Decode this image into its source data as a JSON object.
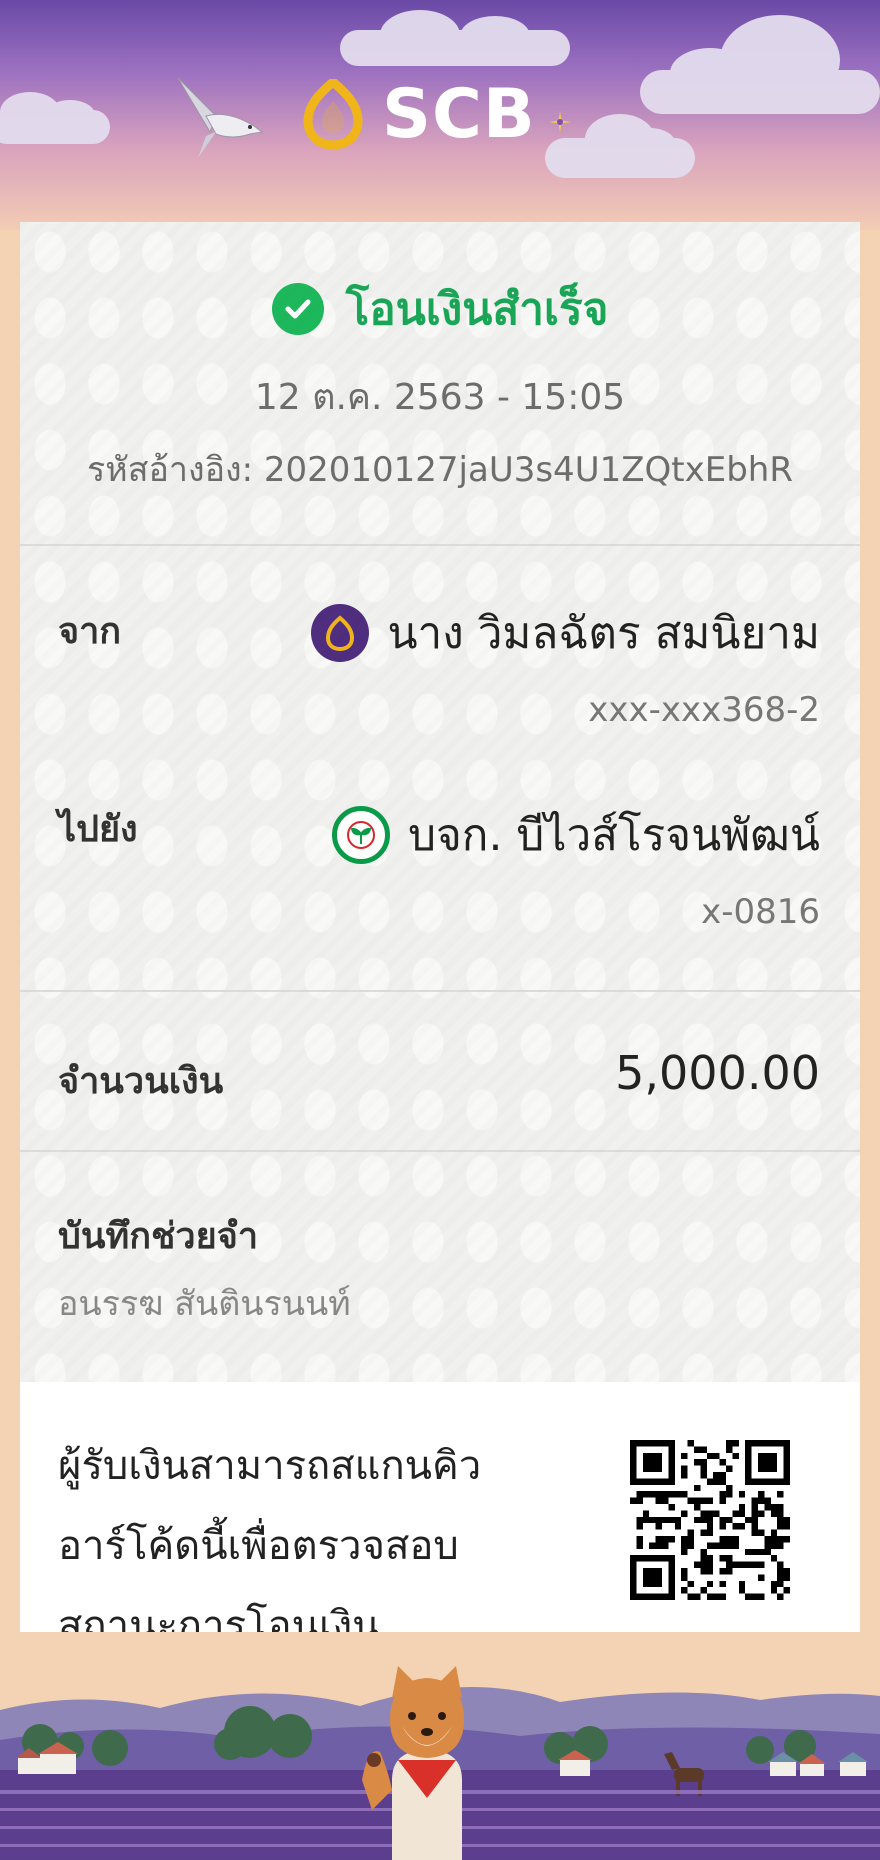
{
  "header": {
    "brand": "SCB",
    "colors": {
      "sky_top": "#6a4aa6",
      "gold": "#f1b51c",
      "purple": "#4f2d7f"
    }
  },
  "receipt": {
    "status_title": "โอนเงินสำเร็จ",
    "status_icon": "check-circle-icon",
    "datetime": "12 ต.ค. 2563 - 15:05",
    "reference_label": "รหัสอ้างอิง:",
    "reference_code": "202010127jaU3s4U1ZQtxEbhR",
    "from": {
      "label": "จาก",
      "bank_icon": "scb-bank-icon",
      "name": "นาง วิมลฉัตร สมนิยาม",
      "account": "xxx-xxx368-2"
    },
    "to": {
      "label": "ไปยัง",
      "bank_icon": "kbank-icon",
      "name": "บจก. บีไวส์โรจนพัฒน์",
      "account": "x-0816"
    },
    "amount": {
      "label": "จำนวนเงิน",
      "value": "5,000.00"
    },
    "memo": {
      "label": "บันทึกช่วยจำ",
      "value": "อนรรฆ สันตินรนนท์"
    },
    "qr": {
      "text_line1": "ผู้รับเงินสามารถสแกนคิว",
      "text_line2": "อาร์โค้ดนี้เพื่อตรวจสอบ",
      "text_line3": "สถานะการโอนเงิน"
    }
  },
  "colors": {
    "success_green": "#1aa657",
    "kbank_green": "#0a9b49",
    "page_bg": "#f4d2b4"
  }
}
